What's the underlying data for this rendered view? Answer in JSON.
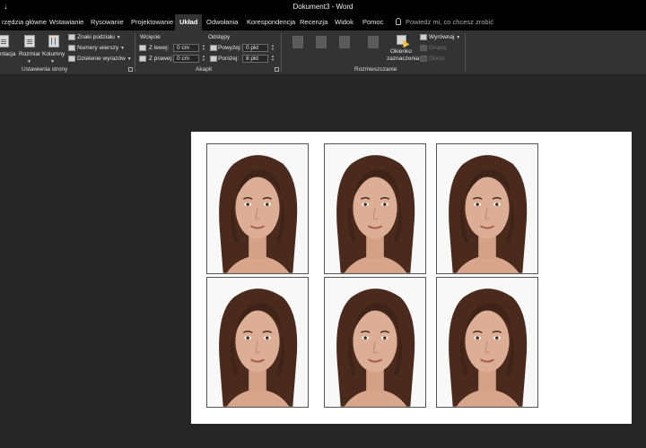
{
  "titlebar": {
    "qat_arrow": "↓",
    "qat_more": "≡",
    "title": "Dokument3  -  Word"
  },
  "tabs": [
    {
      "label": "rzędzia główne"
    },
    {
      "label": "Wstawianie"
    },
    {
      "label": "Rysowanie"
    },
    {
      "label": "Projektowanie"
    },
    {
      "label": "Układ"
    },
    {
      "label": "Odwołania"
    },
    {
      "label": "Korespondencja"
    },
    {
      "label": "Recenzja"
    },
    {
      "label": "Widok"
    },
    {
      "label": "Pomoc"
    }
  ],
  "tell_me": {
    "placeholder": "Powiedz mi, co chcesz zrobić"
  },
  "ribbon": {
    "page_setup": {
      "orientation": "ntacja",
      "size": "Rozmiar",
      "columns": "Kolumny",
      "breaks": "Znaki podziału",
      "line_numbers": "Numery wierszy",
      "hyphenation": "Dzielenie wyrazów",
      "label": "Ustawienia strony"
    },
    "paragraph": {
      "indent_header": "Wcięcie",
      "spacing_header": "Odstępy",
      "left_label": "Z lewej:",
      "left_value": "0 cm",
      "right_label": "Z prawej:",
      "right_value": "0 cm",
      "before_label": "Powyżej:",
      "before_value": "0 pkt",
      "after_label": "Poniżej:",
      "after_value": "8 pkt",
      "label": "Akapit"
    },
    "arrange": {
      "selection_pane": [
        "Okienko",
        "zaznaczenia"
      ],
      "align": "Wyrównaj",
      "group": "Grupuj",
      "rotate": "Obróć",
      "label": "Rozmieszczanie"
    }
  },
  "colors": {
    "ribbon_bg": "#333333",
    "workspace_bg": "#262626",
    "title_bg": "#000000",
    "page_bg": "#ffffff"
  },
  "document": {
    "photo_count": 6
  }
}
